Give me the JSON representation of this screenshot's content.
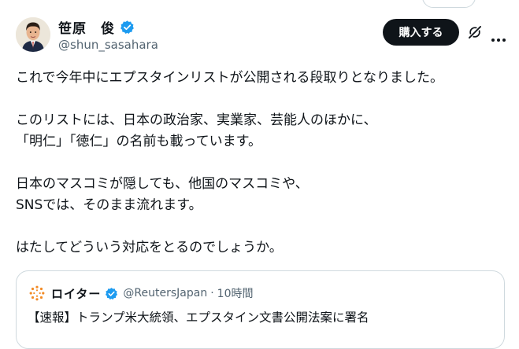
{
  "author": {
    "display_name": "笹原　俊",
    "handle": "@shun_sasahara",
    "verified": true
  },
  "actions": {
    "buy_label": "購入する",
    "grok_icon": "grok-icon",
    "more_icon": "more-icon"
  },
  "tweet": {
    "text": "これで今年中にエプスタインリストが公開される段取りとなりました。\n\nこのリストには、日本の政治家、実業家、芸能人のほかに、\n「明仁」「徳仁」の名前も載っています。\n\n日本のマスコミが隠しても、他国のマスコミや、\nSNSでは、そのまま流れます。\n\nはたしてどういう対応をとるのでしょうか。"
  },
  "quote": {
    "display_name": "ロイター",
    "handle": "@ReutersJapan",
    "separator": "·",
    "time": "10時間",
    "verified": true,
    "text": "【速報】トランプ米大統領、エプスタイン文書公開法案に署名"
  },
  "colors": {
    "text": "#0f1419",
    "secondary": "#536471",
    "verified_blue": "#1d9bf0",
    "button_bg": "#0f1419",
    "border": "#cfd9de",
    "reuters_orange": "#f28b26"
  }
}
